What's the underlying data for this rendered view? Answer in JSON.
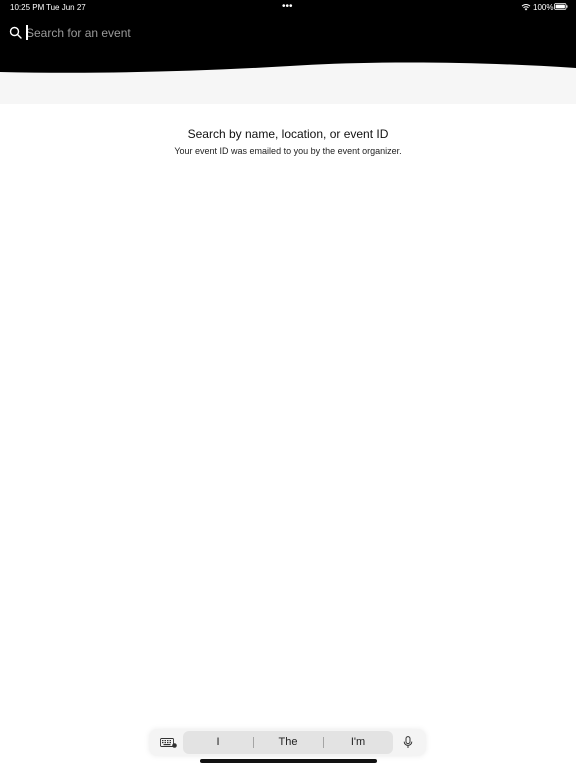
{
  "status_bar": {
    "time": "10:25 PM",
    "date": "Tue Jun 27",
    "dots": "•••",
    "battery": "100%",
    "wifi_icon": "wifi-icon",
    "battery_icon": "battery-full-icon"
  },
  "search": {
    "icon": "search-icon",
    "placeholder": "Search for an event",
    "value": ""
  },
  "empty_state": {
    "title": "Search by name, location, or event ID",
    "subtitle": "Your event ID was emailed to you by the event organizer."
  },
  "keyboard_bar": {
    "keyboard_icon": "keyboard-icon",
    "suggestions": [
      "I",
      "The",
      "I'm"
    ],
    "mic_icon": "microphone-icon"
  },
  "colors": {
    "header_bg": "#000000",
    "header_lower": "#f6f6f6",
    "page_bg": "#ffffff"
  }
}
